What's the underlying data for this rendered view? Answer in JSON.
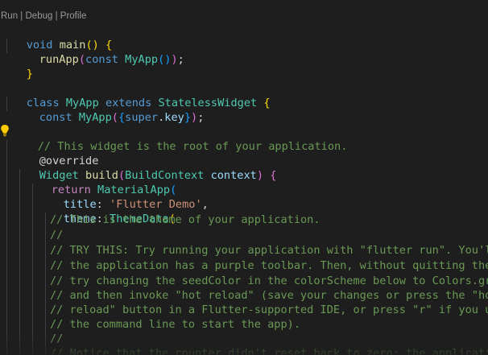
{
  "codelens": {
    "run": "Run",
    "sep1": " | ",
    "debug": "Debug",
    "sep2": " | ",
    "profile": "Profile"
  },
  "icons": {
    "lightbulb": "lightbulb-icon"
  },
  "colors": {
    "background": "#1e1e1e",
    "keyword": "#569cd6",
    "control_keyword": "#c586c0",
    "function": "#dcdcaa",
    "type": "#4ec9b0",
    "parameter": "#9cdcfe",
    "string": "#ce9178",
    "comment": "#6a9955",
    "bracket_1": "#ffd700",
    "bracket_2": "#da70d6",
    "bracket_3": "#179fff"
  },
  "code": {
    "main_sig": [
      "void",
      " ",
      "main",
      "()",
      " ",
      "{"
    ],
    "run_app": [
      "runApp",
      "(",
      "const",
      " ",
      "MyApp",
      "()",
      ")",
      ";"
    ],
    "main_close": "}",
    "class_decl": [
      "class",
      " ",
      "MyApp",
      " ",
      "extends",
      " ",
      "StatelessWidget",
      " ",
      "{"
    ],
    "ctor": [
      "const",
      " ",
      "MyApp",
      "(",
      "{",
      "super",
      ".",
      "key",
      "}",
      ")",
      ";"
    ],
    "comment_root": "// This widget is the root of your application.",
    "override": "@override",
    "build_sig": [
      "Widget",
      " ",
      "build",
      "(",
      "BuildContext",
      " ",
      "context",
      ")",
      " ",
      "{"
    ],
    "return_line": [
      "return",
      " ",
      "MaterialApp",
      "("
    ],
    "title_line": [
      "title",
      ": ",
      "'Flutter Demo'",
      ","
    ],
    "theme_line": [
      "theme",
      ": ",
      "ThemeData",
      "("
    ],
    "comments": [
      "// This is the theme of your application.",
      "//",
      "// TRY THIS: Try running your application with \"flutter run\". You'll see",
      "// the application has a purple toolbar. Then, without quitting the app,",
      "// try changing the seedColor in the colorScheme below to Colors.green",
      "// and then invoke \"hot reload\" (save your changes or press the \"hot",
      "// reload\" button in a Flutter-supported IDE, or press \"r\" if you used",
      "// the command line to start the app).",
      "//",
      "// Notice that the counter didn't reset back to zero; the application"
    ]
  }
}
